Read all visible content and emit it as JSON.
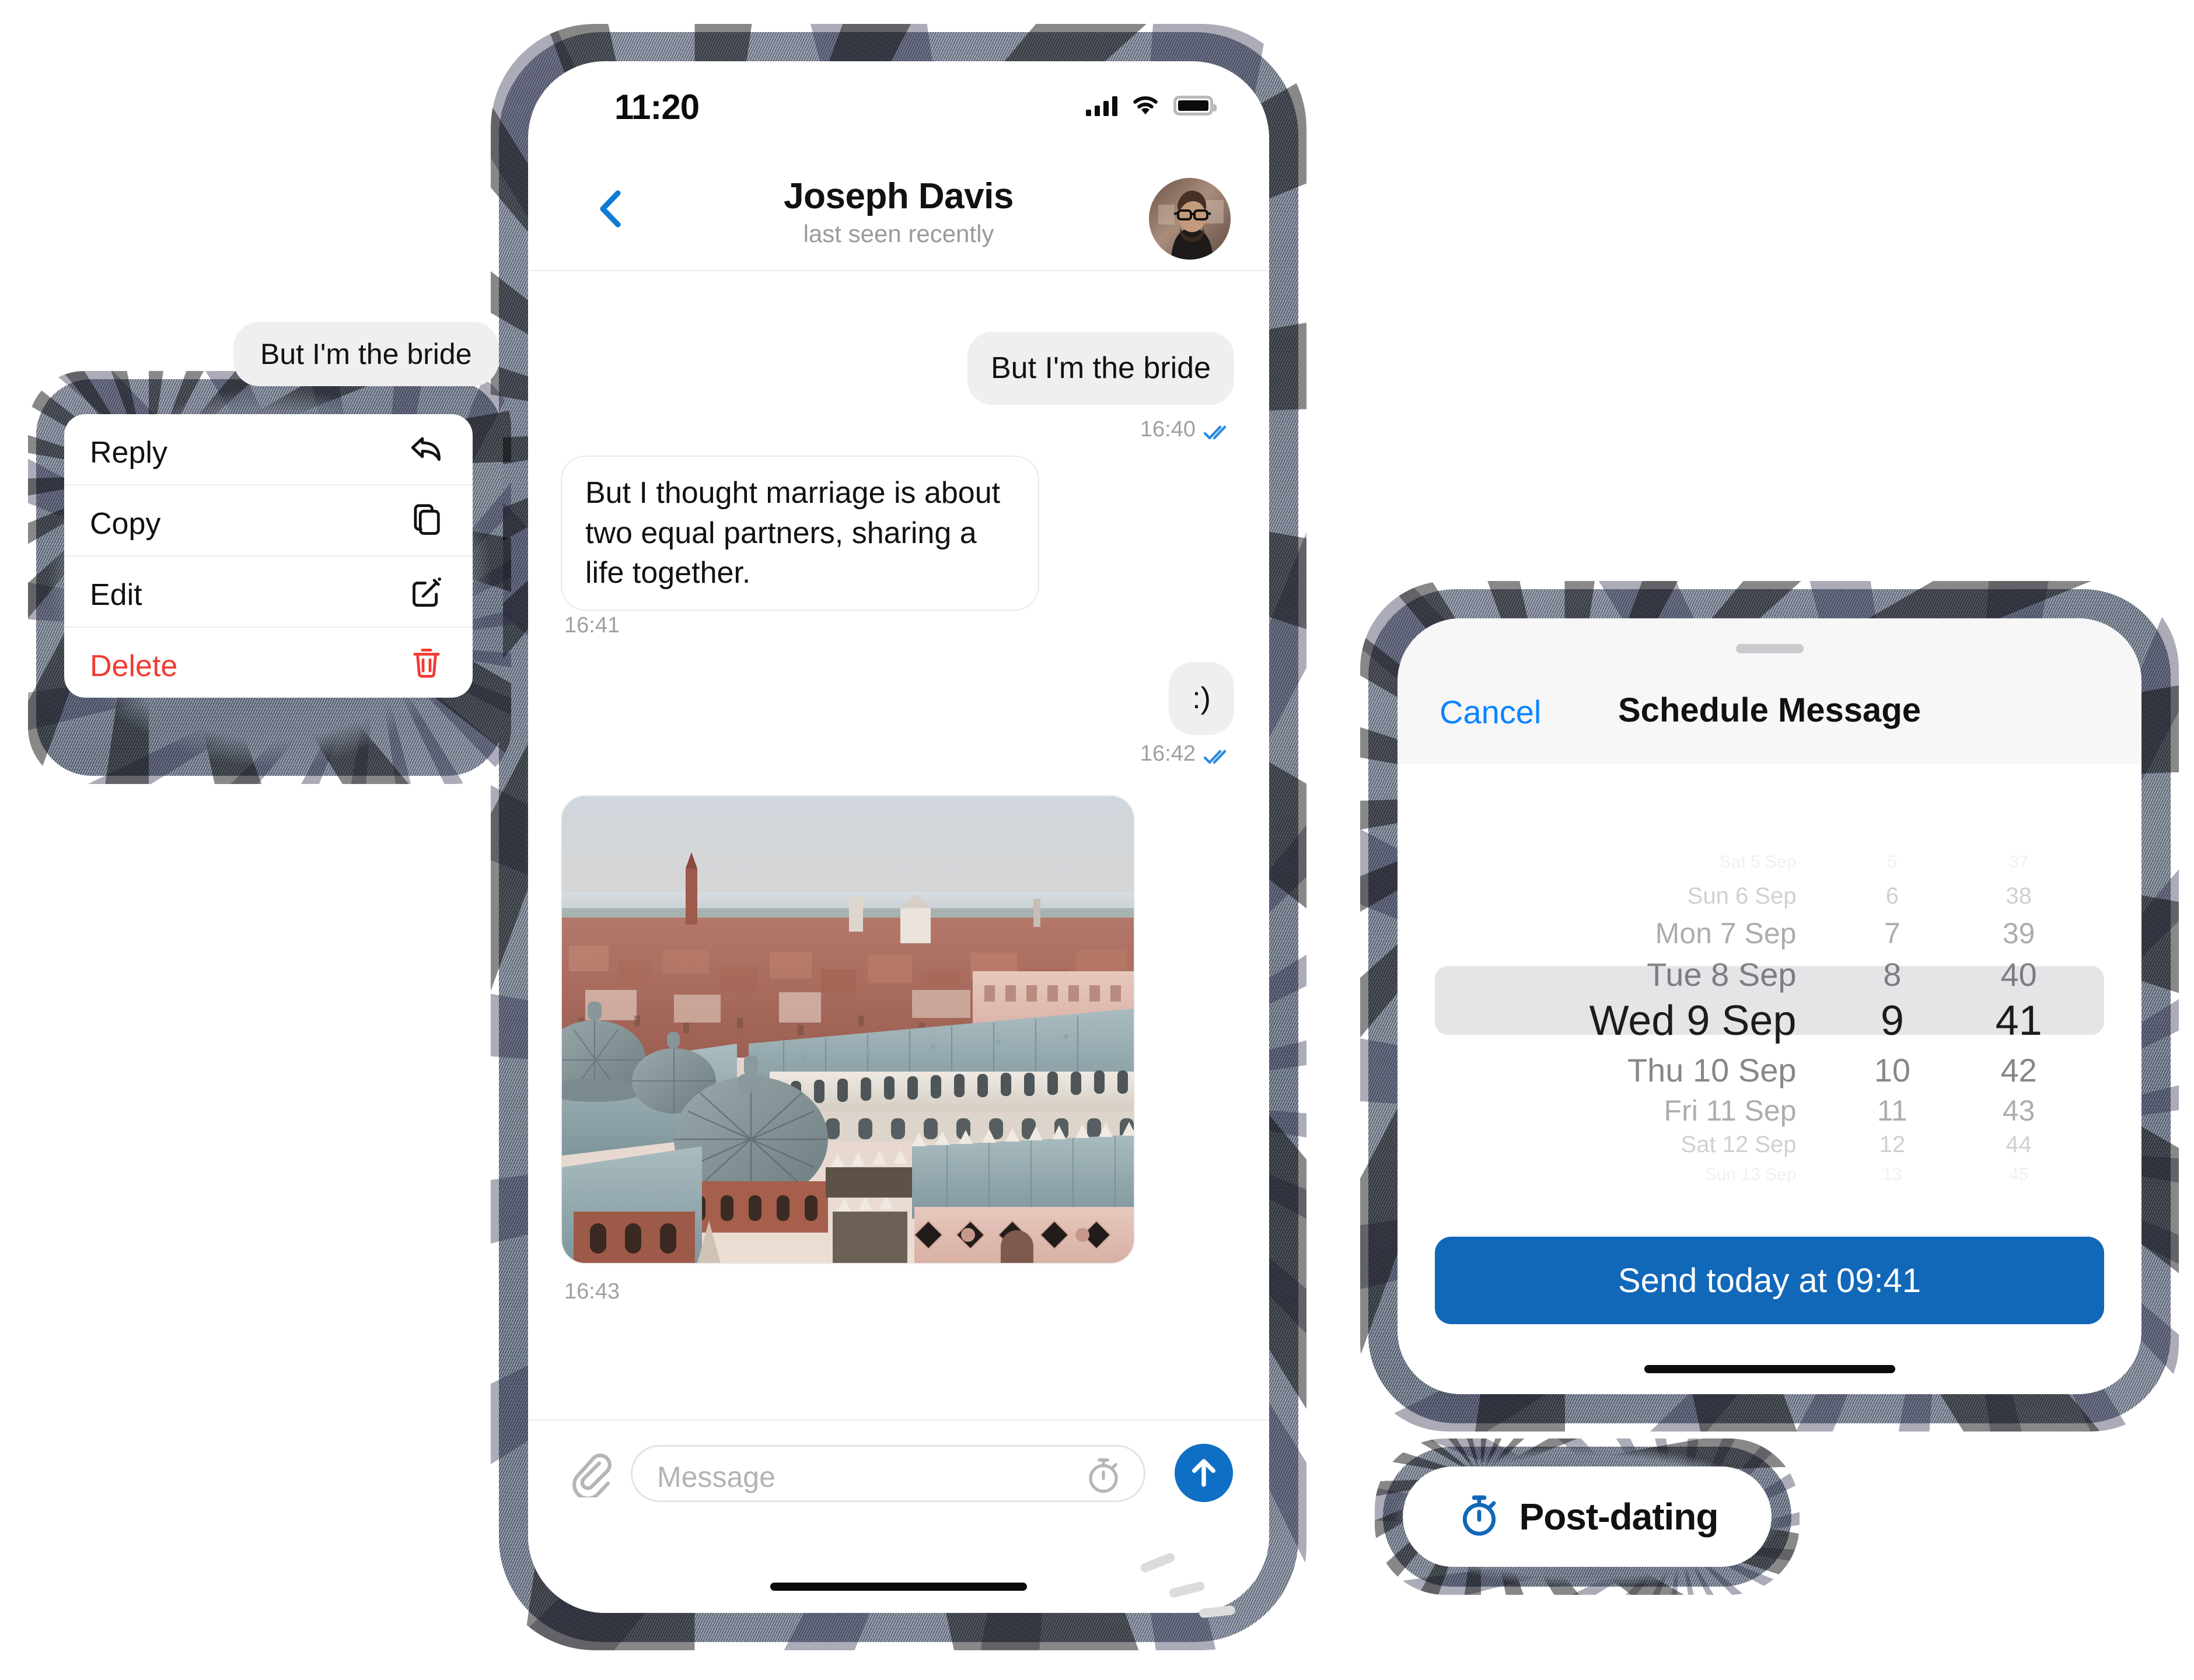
{
  "main_phone": {
    "status_bar": {
      "time": "11:20",
      "icons": [
        "cellular-bars-icon",
        "wifi-icon",
        "battery-icon"
      ]
    },
    "header": {
      "back_icon": "back-chevron-icon",
      "title": "Joseph Davis",
      "subtitle": "last seen recently",
      "avatar": "contact-avatar"
    },
    "messages": [
      {
        "id": "m1",
        "side": "out",
        "type": "text",
        "text": "But I'm the bride",
        "time": "16:40",
        "status": "read-double-check"
      },
      {
        "id": "m2",
        "side": "in",
        "type": "text",
        "text": "But I thought marriage is about two equal partners, sharing a life together.",
        "time": "16:41",
        "status": ""
      },
      {
        "id": "m3",
        "side": "out",
        "type": "text",
        "text": ":)",
        "time": "16:42",
        "status": "read-double-check"
      },
      {
        "id": "m4",
        "side": "in",
        "type": "photo",
        "text": "",
        "time": "16:43",
        "status": "",
        "alt": "Aerial view of Venice rooftops at sunset"
      }
    ],
    "composer": {
      "attach_icon": "paperclip-icon",
      "placeholder": "Message",
      "schedule_icon": "stopwatch-icon",
      "send_icon": "send-arrow-up-icon"
    }
  },
  "floating_bubble": {
    "text": "But I'm the bride"
  },
  "context_menu": {
    "items": [
      {
        "label": "Reply",
        "icon": "reply-arrow-icon",
        "danger": false
      },
      {
        "label": "Copy",
        "icon": "copy-pages-icon",
        "danger": false
      },
      {
        "label": "Edit",
        "icon": "edit-pencil-icon",
        "danger": false
      },
      {
        "label": "Delete",
        "icon": "trash-bin-icon",
        "danger": true
      }
    ]
  },
  "schedule_sheet": {
    "cancel_label": "Cancel",
    "title": "Schedule Message",
    "picker": {
      "columns": [
        "date",
        "hour",
        "minute"
      ],
      "rows": [
        {
          "date": "Sat 5 Sep",
          "hour": "5",
          "minute": "37",
          "selected": false,
          "opacity": 0.08
        },
        {
          "date": "Sun 6 Sep",
          "hour": "6",
          "minute": "38",
          "selected": false,
          "opacity": 0.24
        },
        {
          "date": "Mon 7 Sep",
          "hour": "7",
          "minute": "39",
          "selected": false,
          "opacity": 0.42
        },
        {
          "date": "Tue 8 Sep",
          "hour": "8",
          "minute": "40",
          "selected": false,
          "opacity": 0.62
        },
        {
          "date": "Wed 9 Sep",
          "hour": "9",
          "minute": "41",
          "selected": true,
          "opacity": 1.0
        },
        {
          "date": "Thu 10 Sep",
          "hour": "10",
          "minute": "42",
          "selected": false,
          "opacity": 0.62
        },
        {
          "date": "Fri 11 Sep",
          "hour": "11",
          "minute": "43",
          "selected": false,
          "opacity": 0.42
        },
        {
          "date": "Sat 12 Sep",
          "hour": "12",
          "minute": "44",
          "selected": false,
          "opacity": 0.24
        },
        {
          "date": "Sun 13 Sep",
          "hour": "13",
          "minute": "45",
          "selected": false,
          "opacity": 0.08
        }
      ],
      "selected_index": 4
    },
    "send_button_label": "Send today at 09:41"
  },
  "post_dating_pill": {
    "icon": "stopwatch-icon",
    "label": "Post-dating"
  },
  "colors": {
    "accent_blue": "#0f6fc4",
    "cta_blue": "#1168b9",
    "link_blue": "#0a84ff",
    "danger_red": "#f23b32",
    "bubble_grey": "#efeff0",
    "selection_grey": "#e5e5e7",
    "muted_text": "#9a9a9e"
  }
}
